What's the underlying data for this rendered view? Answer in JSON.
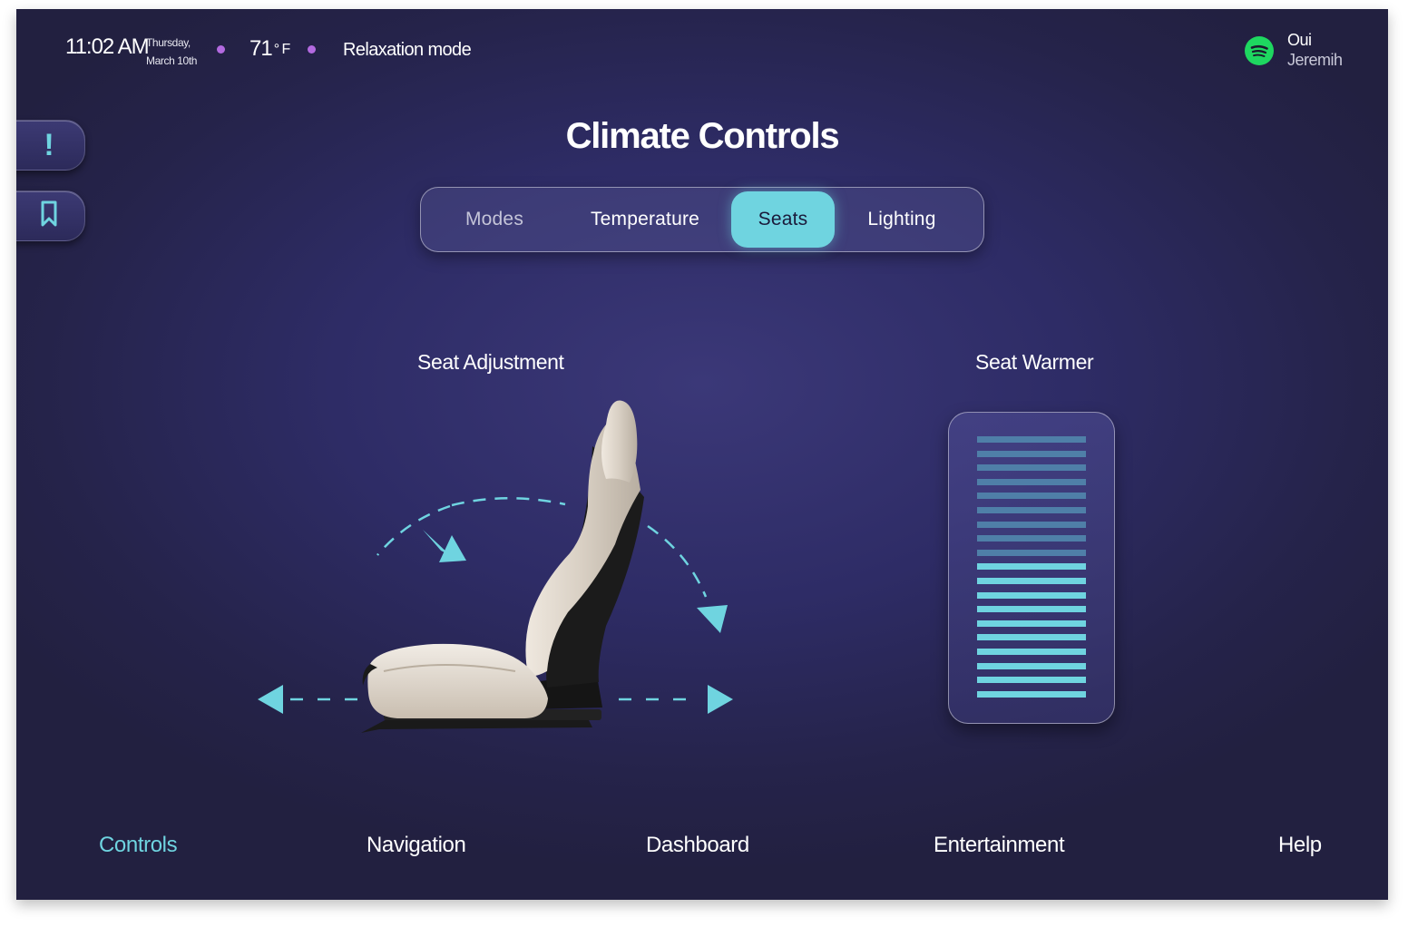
{
  "status_bar": {
    "time": "11:02 AM",
    "day": "Thursday,",
    "date": "March 10th",
    "temperature": "71",
    "temperature_unit": "° F",
    "mode": "Relaxation mode",
    "music_icon": "spotify-icon",
    "track_title": "Oui",
    "track_artist": "Jeremih"
  },
  "side_buttons": [
    {
      "icon": "alert-icon",
      "glyph": "!"
    },
    {
      "icon": "bookmark-icon"
    }
  ],
  "page_title": "Climate Controls",
  "tabs": [
    {
      "label": "Modes",
      "active": false
    },
    {
      "label": "Temperature",
      "active": false
    },
    {
      "label": "Seats",
      "active": true
    },
    {
      "label": "Lighting",
      "active": false
    }
  ],
  "seat_adjustment": {
    "title": "Seat Adjustment"
  },
  "seat_warmer": {
    "title": "Seat Warmer",
    "total_levels": 19,
    "active_levels": 10
  },
  "bottom_nav": [
    {
      "label": "Controls",
      "active": true
    },
    {
      "label": "Navigation",
      "active": false
    },
    {
      "label": "Dashboard",
      "active": false
    },
    {
      "label": "Entertainment",
      "active": false
    },
    {
      "label": "Help",
      "active": false
    }
  ],
  "colors": {
    "accent": "#6fd4e0",
    "status_dot": "#b36ae0",
    "spotify": "#1ed760",
    "background": "#2e2c66",
    "warmer_inactive": "#4f7fa8"
  }
}
